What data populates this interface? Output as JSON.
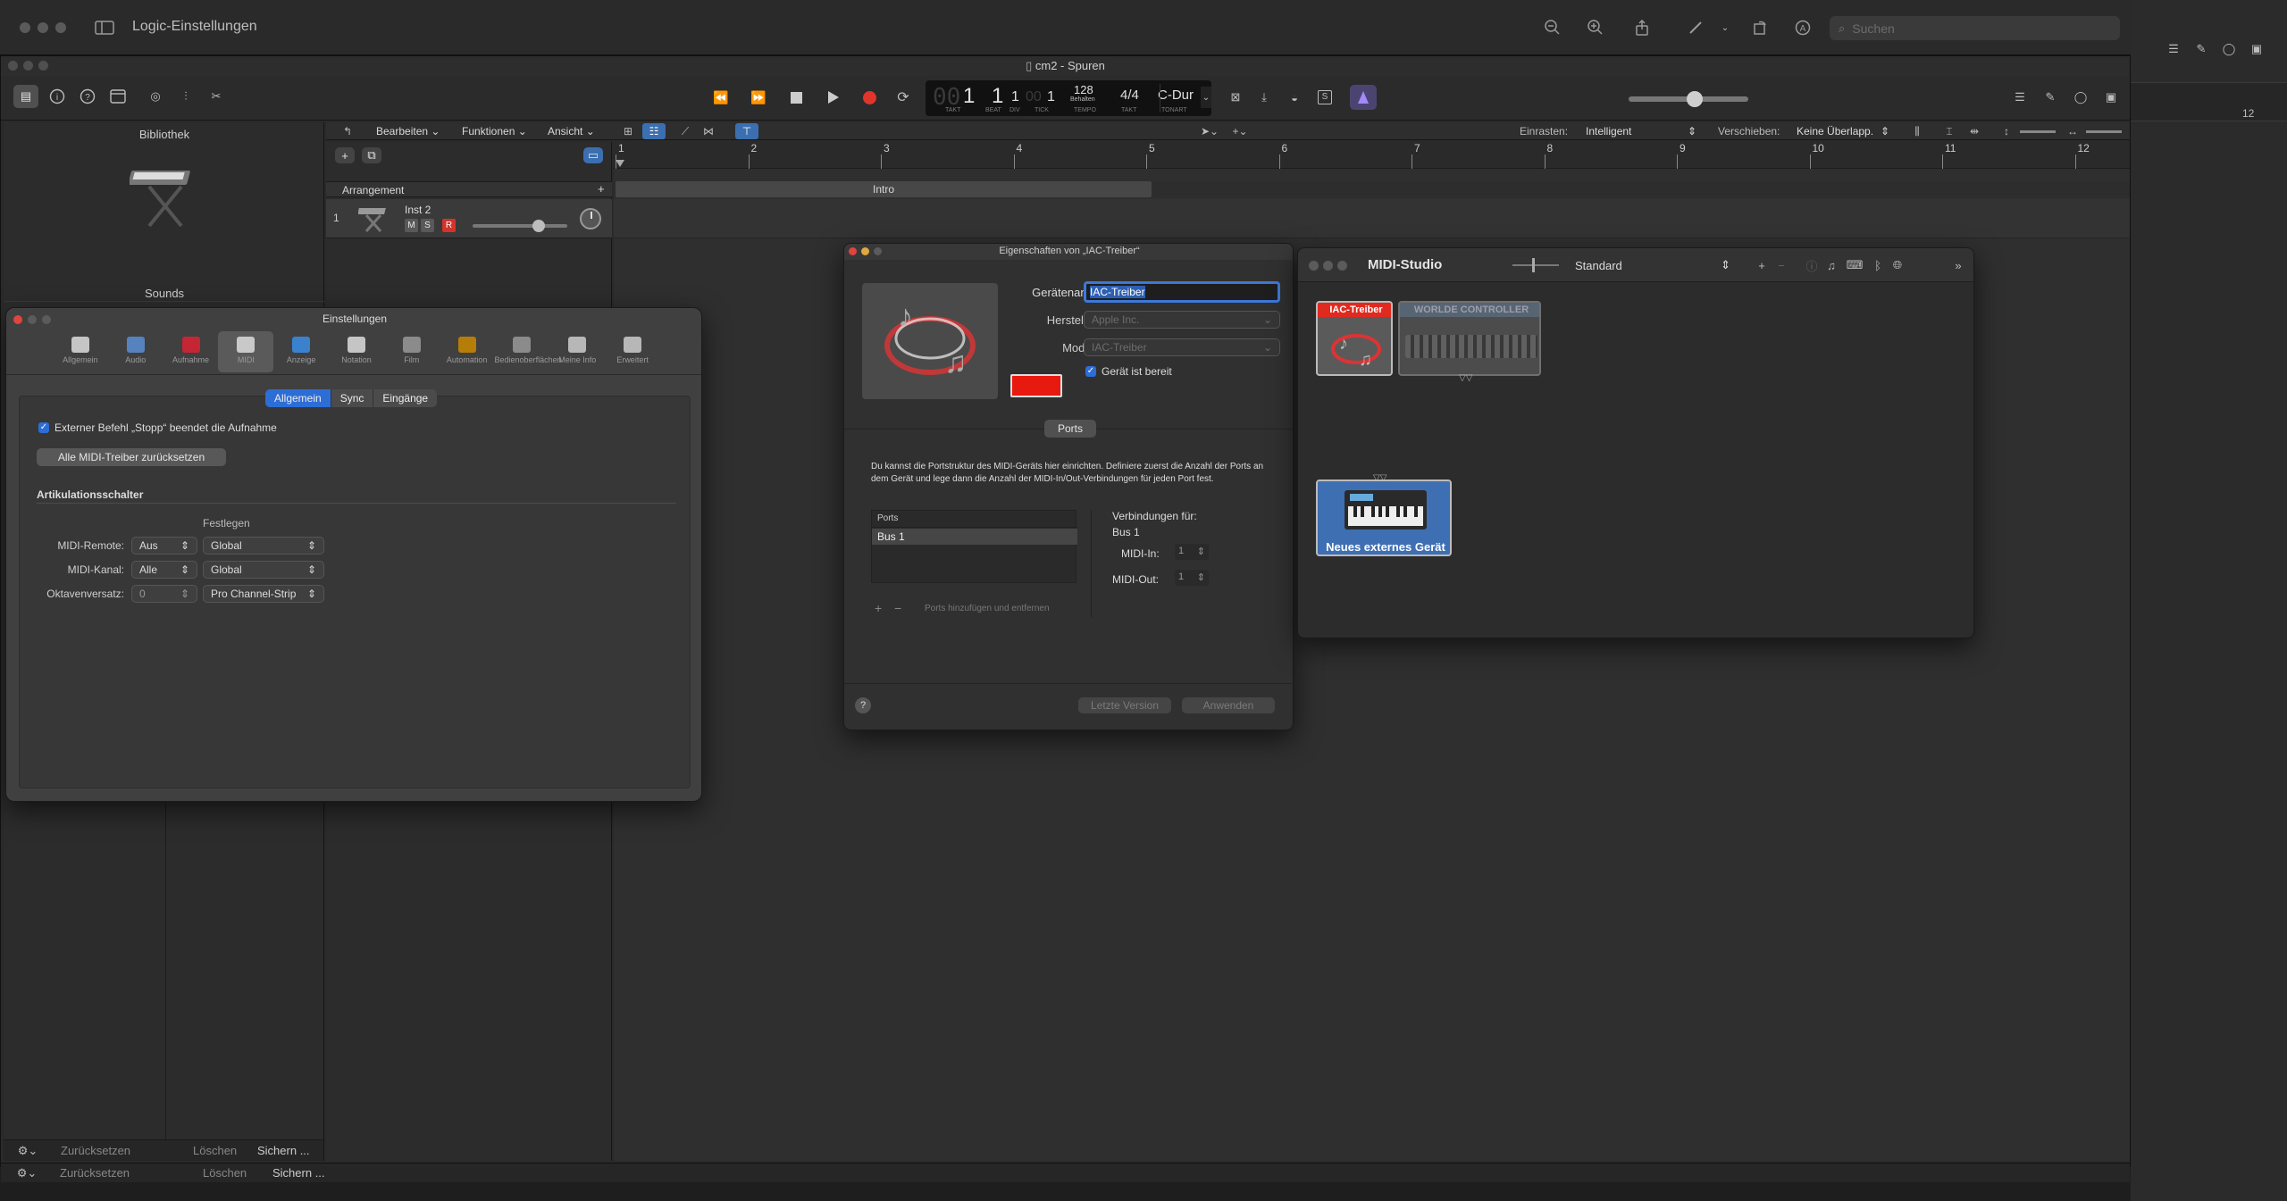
{
  "outer": {
    "title": "Logic-Einstellungen",
    "search_placeholder": "Suchen",
    "ruler_right": "12"
  },
  "main": {
    "title": "cm2 - Spuren",
    "lcd": {
      "bar": "1",
      "beat": "1",
      "div": "1",
      "tick": "1",
      "bar_lbl": "TAKT",
      "beat_lbl": "BEAT",
      "div_lbl": "DIV",
      "tick_lbl": "TICK",
      "tempo": "128",
      "tempo_sub": "Behalten",
      "tempo_lbl": "TEMPO",
      "sig": "4/4",
      "sig_lbl": "TAKT",
      "key": "C-Dur",
      "key_lbl": "TONART"
    },
    "master_volume": 0.55
  },
  "library": {
    "title": "Bibliothek",
    "sounds": "Sounds"
  },
  "tracks_menu": {
    "edit": "Bearbeiten",
    "functions": "Funktionen",
    "view": "Ansicht",
    "snap_label": "Einrasten:",
    "snap_value": "Intelligent",
    "move_label": "Verschieben:",
    "move_value": "Keine Überlapp."
  },
  "arrangement": {
    "label": "Arrangement",
    "section": "Intro"
  },
  "ruler": [
    "1",
    "2",
    "3",
    "4",
    "5",
    "6",
    "7",
    "8",
    "9",
    "10",
    "11",
    "12"
  ],
  "track": {
    "number": "1",
    "name": "Inst 2",
    "m": "M",
    "s": "S",
    "r": "R",
    "volume": 0.7
  },
  "bottom": {
    "reset": "Zurücksetzen",
    "delete": "Löschen",
    "save": "Sichern ..."
  },
  "settings": {
    "title": "Einstellungen",
    "tabs": [
      {
        "label": "Allgemein",
        "icon": "general-icon"
      },
      {
        "label": "Audio",
        "icon": "audio-icon"
      },
      {
        "label": "Aufnahme",
        "icon": "record-icon"
      },
      {
        "label": "MIDI",
        "icon": "midi-icon"
      },
      {
        "label": "Anzeige",
        "icon": "display-icon"
      },
      {
        "label": "Notation",
        "icon": "notation-icon"
      },
      {
        "label": "Film",
        "icon": "film-icon"
      },
      {
        "label": "Automation",
        "icon": "automation-icon"
      },
      {
        "label": "Bedienoberflächen",
        "icon": "control-surfaces-icon"
      },
      {
        "label": "Meine Info",
        "icon": "my-info-icon"
      },
      {
        "label": "Erweitert",
        "icon": "advanced-icon"
      }
    ],
    "seg": [
      "Allgemein",
      "Sync",
      "Eingänge"
    ],
    "stop_checkbox": "Externer Befehl „Stopp“ beendet die Aufnahme",
    "reset_button": "Alle MIDI-Treiber zurücksetzen",
    "artic_header": "Artikulationsschalter",
    "festlegen": "Festlegen",
    "rows": [
      {
        "label": "MIDI-Remote:",
        "value": "Aus",
        "value2": "Global"
      },
      {
        "label": "MIDI-Kanal:",
        "value": "Alle",
        "value2": "Global"
      },
      {
        "label": "Oktavenversatz:",
        "value": "0",
        "value2": "Pro Channel-Strip"
      }
    ]
  },
  "iac": {
    "title": "Eigenschaften von „IAC-Treiber“",
    "name_label": "Gerätename:",
    "name_value": "IAC-Treiber",
    "manu_label": "Hersteller:",
    "manu_value": "Apple Inc.",
    "model_label": "Modell:",
    "model_value": "IAC-Treiber",
    "ready": "Gerät ist bereit",
    "ports_tab": "Ports",
    "desc": "Du kannst die Portstruktur des MIDI-Geräts hier einrichten. Definiere zuerst die Anzahl der Ports an dem Gerät und lege dann die Anzahl der MIDI-In/Out-Verbindungen für jeden Port fest.",
    "ports_header": "Ports",
    "port1": "Bus 1",
    "conn_label": "Verbindungen für:",
    "conn_bus": "Bus 1",
    "midi_in_label": "MIDI-In:",
    "midi_in": "1",
    "midi_out_label": "MIDI-Out:",
    "midi_out": "1",
    "add_remove": "Ports hinzufügen und entfernen",
    "last_version": "Letzte Version",
    "apply": "Anwenden",
    "help": "?",
    "color": "#e8190f"
  },
  "studio": {
    "title": "MIDI-Studio",
    "view": "Standard",
    "dev_iac": "IAC-Treiber",
    "dev_worlde": "WORLDE CONTROLLER",
    "dev_new": "Neues externes Gerät"
  }
}
